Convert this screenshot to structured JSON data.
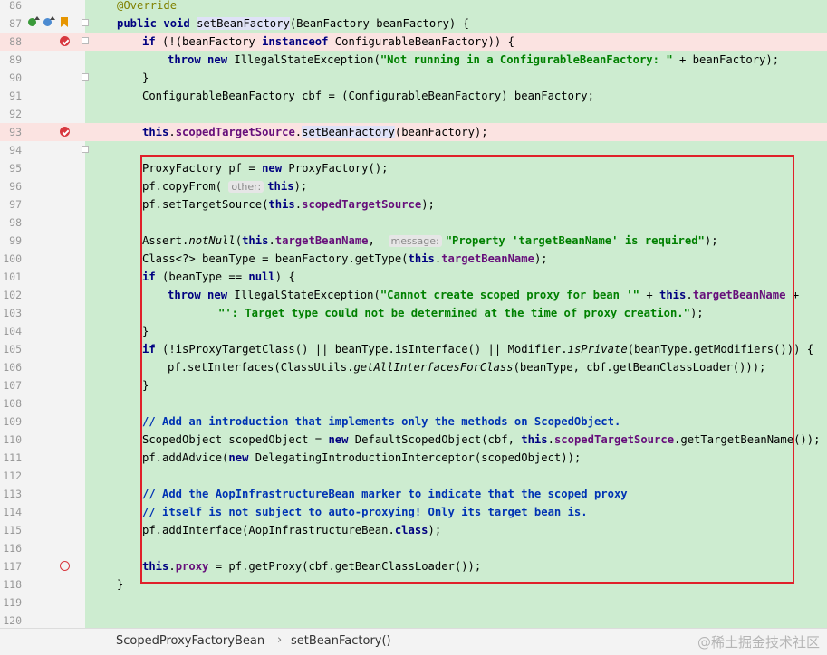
{
  "breadcrumb": {
    "class": "ScopedProxyFactoryBean",
    "separator": "›",
    "method": "setBeanFactory()"
  },
  "watermark": "@稀土掘金技术社区",
  "lines": [
    {
      "n": "86"
    },
    {
      "n": "87"
    },
    {
      "n": "88"
    },
    {
      "n": "89"
    },
    {
      "n": "90"
    },
    {
      "n": "91"
    },
    {
      "n": "92"
    },
    {
      "n": "93"
    },
    {
      "n": "94"
    },
    {
      "n": "95"
    },
    {
      "n": "96"
    },
    {
      "n": "97"
    },
    {
      "n": "98"
    },
    {
      "n": "99"
    },
    {
      "n": "100"
    },
    {
      "n": "101"
    },
    {
      "n": "102"
    },
    {
      "n": "103"
    },
    {
      "n": "104"
    },
    {
      "n": "105"
    },
    {
      "n": "106"
    },
    {
      "n": "107"
    },
    {
      "n": "108"
    },
    {
      "n": "109"
    },
    {
      "n": "110"
    },
    {
      "n": "111"
    },
    {
      "n": "112"
    },
    {
      "n": "113"
    },
    {
      "n": "114"
    },
    {
      "n": "115"
    },
    {
      "n": "116"
    },
    {
      "n": "117"
    },
    {
      "n": "118"
    },
    {
      "n": "119"
    },
    {
      "n": "120"
    }
  ],
  "code": {
    "l86": "@Override",
    "l87a": "public",
    "l87b": "void",
    "l87c": "setBeanFactory",
    "l87d": "(BeanFactory beanFactory) {",
    "l88a": "if",
    "l88b": " (!(beanFactory ",
    "l88c": "instanceof",
    "l88d": " ConfigurableBeanFactory)) {",
    "l89a": "throw",
    "l89b": "new",
    "l89c": " IllegalStateException(",
    "l89d": "\"Not running in a ConfigurableBeanFactory: \"",
    "l89e": " + beanFactory);",
    "l90": "}",
    "l91": "ConfigurableBeanFactory cbf = (ConfigurableBeanFactory) beanFactory;",
    "l93a": "this",
    "l93b": ".",
    "l93c": "scopedTargetSource",
    "l93d": ".",
    "l93e": "setBeanFactory",
    "l93f": "(beanFactory);",
    "l95a": "ProxyFactory pf = ",
    "l95b": "new",
    "l95c": " ProxyFactory();",
    "l96a": "pf.copyFrom( ",
    "l96hint": "other:",
    "l96b": "this",
    "l96c": ");",
    "l97a": "pf.setTargetSource(",
    "l97b": "this",
    "l97c": ".",
    "l97d": "scopedTargetSource",
    "l97e": ");",
    "l99a": "Assert.",
    "l99b": "notNull",
    "l99c": "(",
    "l99d": "this",
    "l99e": ".",
    "l99f": "targetBeanName",
    "l99g": ",  ",
    "l99hint": "message:",
    "l99h": "\"Property 'targetBeanName' is required\"",
    "l99i": ");",
    "l100a": "Class<?> beanType = beanFactory.getType(",
    "l100b": "this",
    "l100c": ".",
    "l100d": "targetBeanName",
    "l100e": ");",
    "l101a": "if",
    "l101b": " (beanType == ",
    "l101c": "null",
    "l101d": ") {",
    "l102a": "throw",
    "l102b": "new",
    "l102c": " IllegalStateException(",
    "l102d": "\"Cannot create scoped proxy for bean '\"",
    "l102e": " + ",
    "l102f": "this",
    "l102g": ".",
    "l102h": "targetBeanName",
    "l102i": " +",
    "l103": "\"': Target type could not be determined at the time of proxy creation.\"",
    "l103b": ");",
    "l104": "}",
    "l105a": "if",
    "l105b": " (!isProxyTargetClass() || beanType.isInterface() || Modifier.",
    "l105c": "isPrivate",
    "l105d": "(beanType.getModifiers())) {",
    "l106a": "pf.setInterfaces(ClassUtils.",
    "l106b": "getAllInterfacesForClass",
    "l106c": "(beanType, cbf.getBeanClassLoader()));",
    "l107": "}",
    "l109": "// Add an introduction that implements only the methods on ScopedObject.",
    "l110a": "ScopedObject scopedObject = ",
    "l110b": "new",
    "l110c": " DefaultScopedObject(cbf, ",
    "l110d": "this",
    "l110e": ".",
    "l110f": "scopedTargetSource",
    "l110g": ".getTargetBeanName());",
    "l111a": "pf.addAdvice(",
    "l111b": "new",
    "l111c": " DelegatingIntroductionInterceptor(scopedObject));",
    "l113": "// Add the AopInfrastructureBean marker to indicate that the scoped proxy",
    "l114": "// itself is not subject to auto-proxying! Only its target bean is.",
    "l115a": "pf.addInterface(AopInfrastructureBean.",
    "l115b": "class",
    "l115c": ");",
    "l117a": "this",
    "l117b": ".",
    "l117c": "proxy",
    "l117d": " = pf.getProxy(cbf.getBeanClassLoader());",
    "l118": "}"
  }
}
